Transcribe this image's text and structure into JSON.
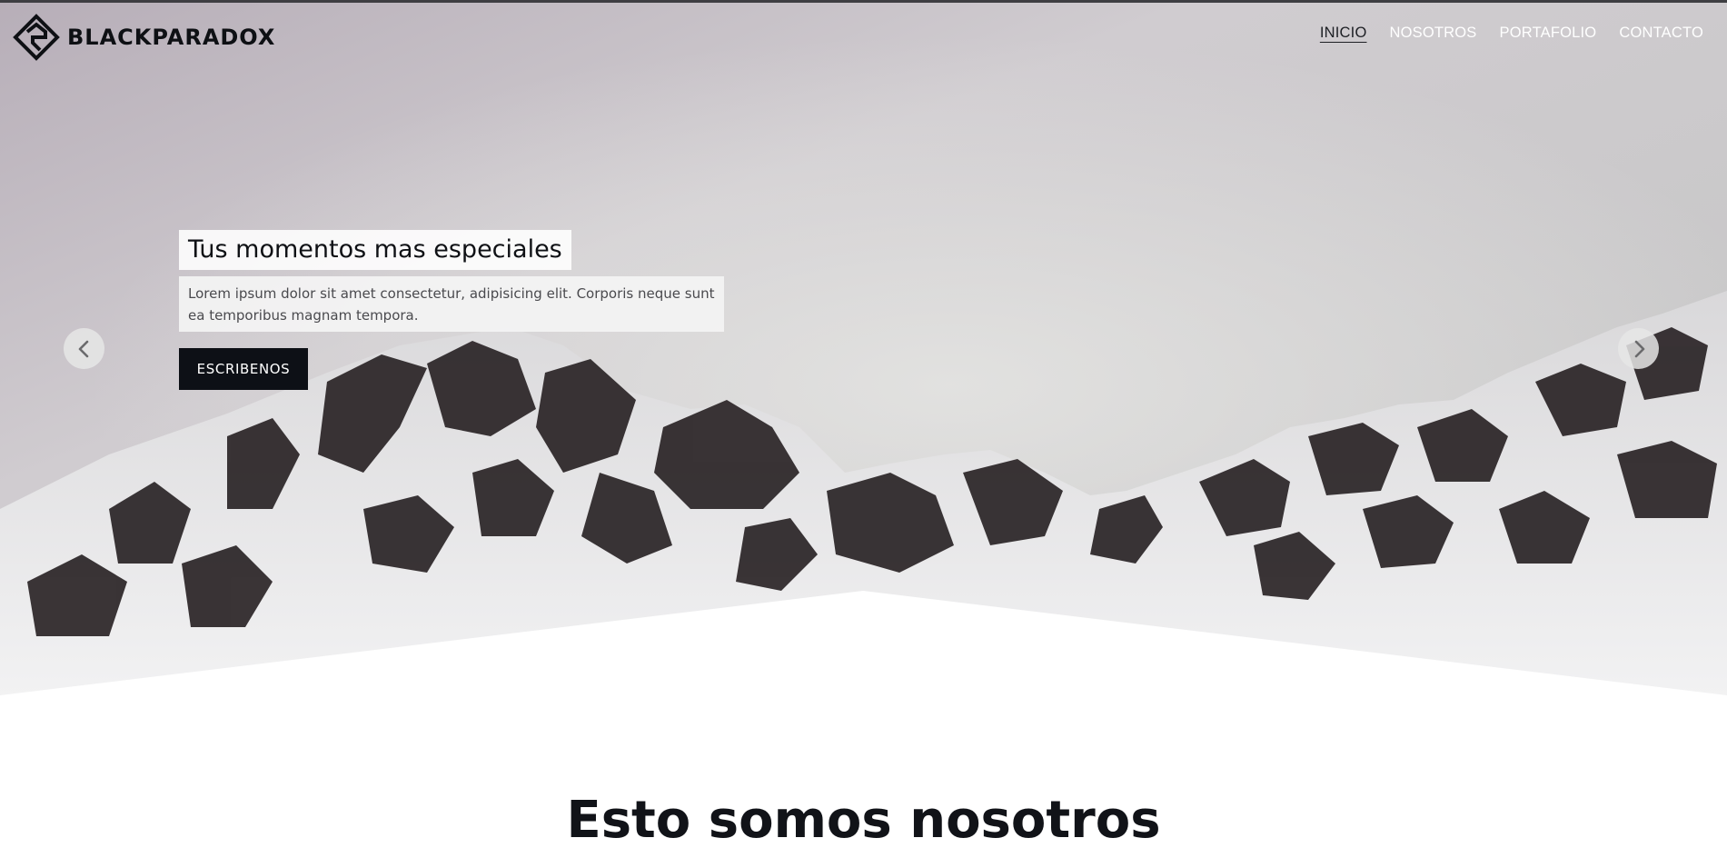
{
  "brand": {
    "name": "BLACKPARADOX"
  },
  "nav": {
    "items": [
      {
        "label": "INICIO",
        "active": true
      },
      {
        "label": "NOSOTROS",
        "active": false
      },
      {
        "label": "PORTAFOLIO",
        "active": false
      },
      {
        "label": "CONTACTO",
        "active": false
      }
    ]
  },
  "hero": {
    "title": "Tus momentos mas especiales",
    "text": "Lorem ipsum dolor sit amet consectetur, adipisicing elit. Corporis neque sunt ea temporibus magnam tempora.",
    "cta_label": "ESCRIBENOS",
    "prev_icon": "chevron-left-icon",
    "next_icon": "chevron-right-icon"
  },
  "about": {
    "title": "Esto somos nosotros"
  },
  "colors": {
    "dark": "#0d1016",
    "nav_text": "#ffffff",
    "active_nav": "#1d1f24"
  }
}
